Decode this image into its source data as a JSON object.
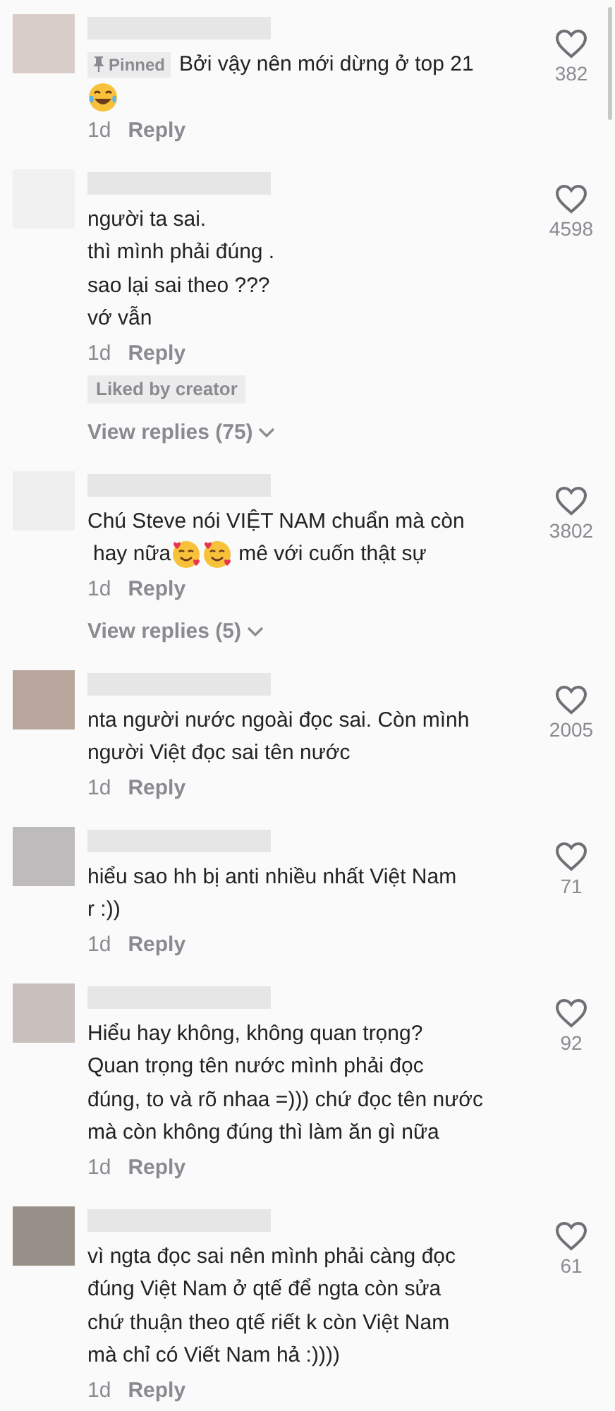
{
  "comments": [
    {
      "color": "#d9cdc9",
      "pinned_label": "Pinned",
      "body": [
        {
          "kind": "text",
          "text": "Bởi vậy nên mới dừng ở top 21"
        },
        {
          "kind": "line_break"
        },
        {
          "kind": "laughing_emoji"
        }
      ],
      "time": "1d",
      "reply": "Reply",
      "likes": "382"
    },
    {
      "color": "#f1f1f1",
      "body": [
        {
          "kind": "text",
          "text": "người ta sai.\nthì mình phải đúng .\nsao lại sai theo ???\nvớ vẫn"
        }
      ],
      "time": "1d",
      "reply": "Reply",
      "badge": "Liked by creator",
      "view_replies": "View replies (75)",
      "likes": "4598"
    },
    {
      "color": "#efefef",
      "body": [
        {
          "kind": "text",
          "text": "Chú Steve nói VIỆT NAM chuẩn mà còn"
        },
        {
          "kind": "line_break"
        },
        {
          "kind": "text",
          "text": "hay nữa"
        },
        {
          "kind": "hearts_emoji"
        },
        {
          "kind": "hearts_emoji"
        },
        {
          "kind": "text",
          "text": "mê với cuốn thật sự"
        }
      ],
      "time": "1d",
      "reply": "Reply",
      "view_replies": "View replies (5)",
      "likes": "3802"
    },
    {
      "color": "#b8a69c",
      "body": [
        {
          "kind": "text",
          "text": "nta người nước ngoài đọc sai. Còn mình\nngười Việt đọc sai tên nước"
        }
      ],
      "time": "1d",
      "reply": "Reply",
      "likes": "2005"
    },
    {
      "color": "#bdbbbb",
      "body": [
        {
          "kind": "text",
          "text": "hiểu sao hh bị anti nhiều nhất Việt Nam\nr :))"
        }
      ],
      "time": "1d",
      "reply": "Reply",
      "likes": "71"
    },
    {
      "color": "#c9bfbd",
      "body": [
        {
          "kind": "text",
          "text": "Hiểu hay không, không quan trọng?\nQuan trọng tên nước mình phải đọc\nđúng, to và rõ nhaa =))) chứ đọc tên nước\nmà còn không đúng thì làm ăn gì nữa"
        }
      ],
      "time": "1d",
      "reply": "Reply",
      "likes": "92"
    },
    {
      "color": "#989088",
      "body": [
        {
          "kind": "text",
          "text": "vì ngta đọc sai nên mình phải càng đọc\nđúng Việt Nam ở qtế để ngta còn sửa\nchứ thuận theo qtế riết k còn Việt Nam\nmà chỉ có Viết Nam hả :))))"
        }
      ],
      "time": "1d",
      "reply": "Reply",
      "likes": "61"
    }
  ]
}
